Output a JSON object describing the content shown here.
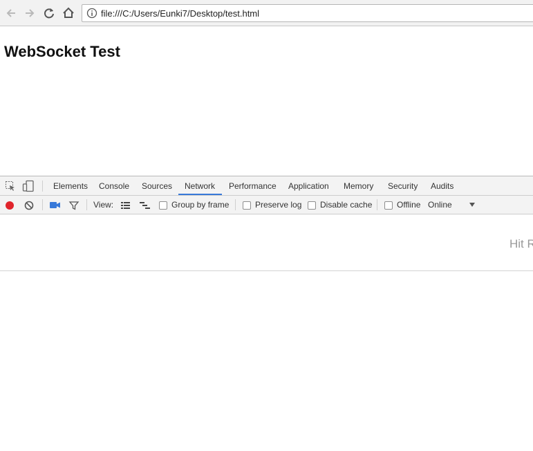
{
  "browser": {
    "url": "file:///C:/Users/Eunki7/Desktop/test.html"
  },
  "page": {
    "title": "WebSocket Test"
  },
  "devtools": {
    "tabs": [
      "Elements",
      "Console",
      "Sources",
      "Network",
      "Performance",
      "Application",
      "Memory",
      "Security",
      "Audits"
    ],
    "active_tab": "Network",
    "network_toolbar": {
      "view_label": "View:",
      "group_by_frame": "Group by frame",
      "preserve_log": "Preserve log",
      "disable_cache": "Disable cache",
      "offline": "Offline",
      "throttle_value": "Online"
    },
    "hint_text": "Hit R",
    "colors": {
      "record": "#e0242b",
      "accent": "#3879d9"
    }
  }
}
